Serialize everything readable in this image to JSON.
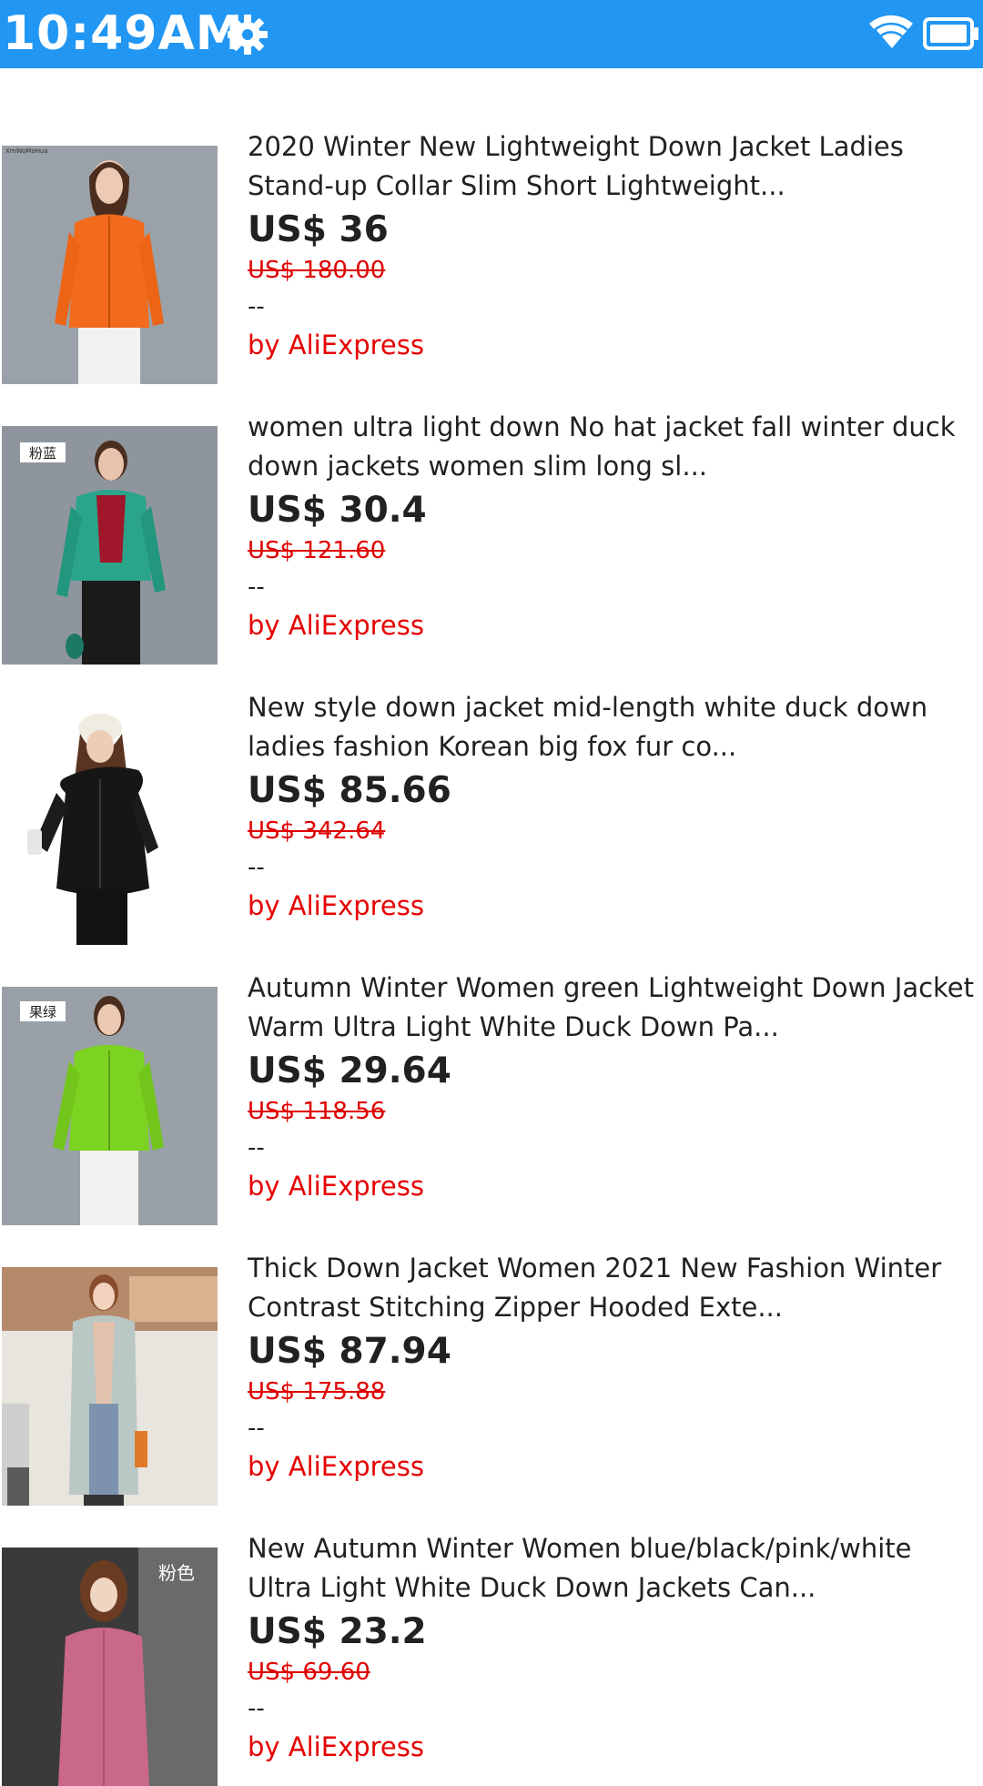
{
  "status_bar": {
    "time": "10:49AM",
    "background": "#2196f3",
    "icons": [
      "gear-icon",
      "wifi-icon",
      "battery-icon"
    ]
  },
  "products": [
    {
      "title": "2020 Winter New Lightweight Down Jacket Ladies Stand-up Collar Slim Short Lightweight...",
      "price": "US$ 36",
      "original_price": "US$ 180.00",
      "rating": "--",
      "seller": "by AliExpress",
      "image": "orange-down-jacket"
    },
    {
      "title": "women ultra light down No hat jacket fall winter duck down jackets women slim long sl...",
      "price": "US$ 30.4",
      "original_price": "US$ 121.60",
      "rating": "--",
      "seller": "by AliExpress",
      "image": "teal-down-jacket",
      "image_tag": "粉蓝"
    },
    {
      "title": "New style down jacket mid-length white duck down ladies fashion Korean big fox fur co...",
      "price": "US$ 85.66",
      "original_price": "US$ 342.64",
      "rating": "--",
      "seller": "by AliExpress",
      "image": "black-hooded-down-coat"
    },
    {
      "title": "Autumn Winter Women green Lightweight Down Jacket Warm Ultra Light White Duck Down Pa...",
      "price": "US$ 29.64",
      "original_price": "US$ 118.56",
      "rating": "--",
      "seller": "by AliExpress",
      "image": "green-down-jacket",
      "image_tag": "果绿"
    },
    {
      "title": "Thick Down Jacket Women 2021 New Fashion Winter Contrast Stitching Zipper Hooded Exte...",
      "price": "US$ 87.94",
      "original_price": "US$ 175.88",
      "rating": "--",
      "seller": "by AliExpress",
      "image": "silver-long-down-coat"
    },
    {
      "title": "New Autumn Winter Women blue/black/pink/white Ultra Light White Duck Down Jackets Can...",
      "price": "US$ 23.2",
      "original_price": "US$ 69.60",
      "rating": "--",
      "seller": "by AliExpress",
      "image": "pink-down-jacket",
      "image_tag": "粉色"
    }
  ]
}
